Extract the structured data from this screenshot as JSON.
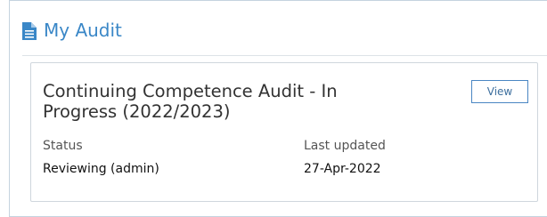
{
  "panel": {
    "title": "My Audit",
    "icon": "document-icon",
    "title_color": "#3a87c7"
  },
  "audit_card": {
    "title": "Continuing Competence Audit - In Progress (2022/2023)",
    "view_label": "View",
    "status_label": "Status",
    "status_value": "Reviewing (admin)",
    "updated_label": "Last updated",
    "updated_value": "27-Apr-2022"
  }
}
